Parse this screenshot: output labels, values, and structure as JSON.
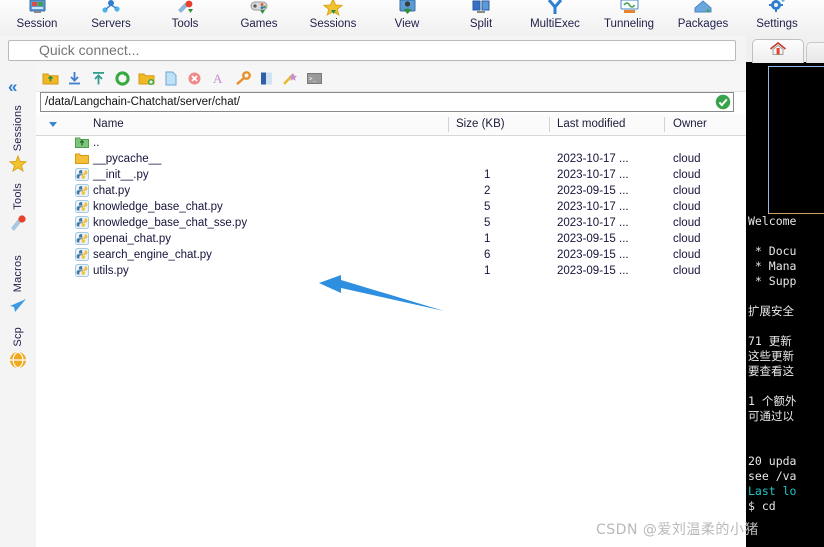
{
  "ribbon": {
    "items": [
      {
        "label": "Session",
        "icon": "session-icon"
      },
      {
        "label": "Servers",
        "icon": "servers-icon"
      },
      {
        "label": "Tools",
        "icon": "tools-icon"
      },
      {
        "label": "Games",
        "icon": "games-icon"
      },
      {
        "label": "Sessions",
        "icon": "sessions-star-icon"
      },
      {
        "label": "View",
        "icon": "view-icon"
      },
      {
        "label": "Split",
        "icon": "split-icon"
      },
      {
        "label": "MultiExec",
        "icon": "multiexec-icon"
      },
      {
        "label": "Tunneling",
        "icon": "tunneling-icon"
      },
      {
        "label": "Packages",
        "icon": "packages-icon"
      },
      {
        "label": "Settings",
        "icon": "settings-gear-icon"
      }
    ]
  },
  "quick_connect": {
    "placeholder": "Quick connect...",
    "value": ""
  },
  "sidebar": {
    "collapse_glyph": "«",
    "tabs": [
      {
        "label": "Sessions",
        "icon": "star-icon"
      },
      {
        "label": "Tools",
        "icon": "wrench-icon"
      },
      {
        "label": "Macros",
        "icon": "paper-plane-icon"
      },
      {
        "label": "Scp",
        "icon": "globe-icon"
      }
    ]
  },
  "browser": {
    "toolbar": [
      {
        "name": "parent-folder-icon",
        "title": "Go to parent directory"
      },
      {
        "name": "download-icon",
        "title": "Download"
      },
      {
        "name": "upload-icon",
        "title": "Upload"
      },
      {
        "name": "refresh-icon",
        "title": "Refresh"
      },
      {
        "name": "new-folder-icon",
        "title": "New folder"
      },
      {
        "name": "new-file-icon",
        "title": "New file"
      },
      {
        "name": "delete-icon",
        "title": "Delete"
      },
      {
        "name": "text-mode-icon",
        "title": "Text"
      },
      {
        "name": "permissions-key-icon",
        "title": "Permissions"
      },
      {
        "name": "bookmark-icon",
        "title": "Bookmark"
      },
      {
        "name": "magic-wand-icon",
        "title": "Follow terminal folder"
      },
      {
        "name": "terminal-icon",
        "title": "Open terminal here"
      }
    ],
    "path": "/data/Langchain-Chatchat/server/chat/",
    "path_status": "ok",
    "columns": [
      "Name",
      "Size (KB)",
      "Last modified",
      "Owner"
    ],
    "files": [
      {
        "name": "..",
        "icon": "up-folder-icon",
        "size": "",
        "modified": "",
        "owner": ""
      },
      {
        "name": "__pycache__",
        "icon": "folder-icon",
        "size": "",
        "modified": "2023-10-17 ...",
        "owner": "cloud"
      },
      {
        "name": "__init__.py",
        "icon": "python-icon",
        "size": "1",
        "modified": "2023-10-17 ...",
        "owner": "cloud"
      },
      {
        "name": "chat.py",
        "icon": "python-icon",
        "size": "2",
        "modified": "2023-09-15 ...",
        "owner": "cloud"
      },
      {
        "name": "knowledge_base_chat.py",
        "icon": "python-icon",
        "size": "5",
        "modified": "2023-10-17 ...",
        "owner": "cloud"
      },
      {
        "name": "knowledge_base_chat_sse.py",
        "icon": "python-icon",
        "size": "5",
        "modified": "2023-10-17 ...",
        "owner": "cloud"
      },
      {
        "name": "openai_chat.py",
        "icon": "python-icon",
        "size": "1",
        "modified": "2023-09-15 ...",
        "owner": "cloud"
      },
      {
        "name": "search_engine_chat.py",
        "icon": "python-icon",
        "size": "6",
        "modified": "2023-09-15 ...",
        "owner": "cloud"
      },
      {
        "name": "utils.py",
        "icon": "python-icon",
        "size": "1",
        "modified": "2023-09-15 ...",
        "owner": "cloud"
      }
    ]
  },
  "annotation": {
    "arrow_color": "#2e8fe0",
    "points_at": "knowledge_base_chat_sse.py"
  },
  "terminal": {
    "tab_icon": "home-tab-icon",
    "lines": [
      {
        "text": "Welcome",
        "color": "c-white"
      },
      {
        "text": "",
        "color": "c-white"
      },
      {
        "text": " * Docu",
        "color": "c-white"
      },
      {
        "text": " * Mana",
        "color": "c-white"
      },
      {
        "text": " * Supp",
        "color": "c-white"
      },
      {
        "text": "",
        "color": "c-white"
      },
      {
        "text": "扩展安全",
        "color": "c-white"
      },
      {
        "text": "",
        "color": "c-white"
      },
      {
        "text": "71 更新",
        "color": "c-white"
      },
      {
        "text": "这些更新",
        "color": "c-white"
      },
      {
        "text": "要查看这",
        "color": "c-white"
      },
      {
        "text": "",
        "color": "c-white"
      },
      {
        "text": "1 个额外",
        "color": "c-white"
      },
      {
        "text": "可通过以",
        "color": "c-white"
      },
      {
        "text": "",
        "color": "c-white"
      },
      {
        "text": "",
        "color": "c-white"
      },
      {
        "text": "20 upda",
        "color": "c-white"
      },
      {
        "text": "see /va",
        "color": "c-white"
      },
      {
        "text": "Last lo",
        "color": "c-cyan"
      },
      {
        "text": "$ cd",
        "color": "c-white"
      }
    ]
  },
  "watermark": {
    "text": "CSDN @爱刘温柔的小猪"
  }
}
